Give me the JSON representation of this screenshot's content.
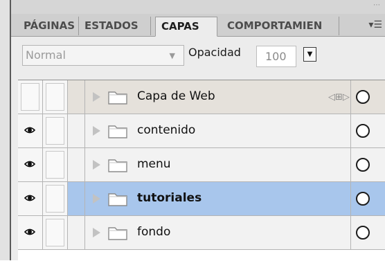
{
  "tabs": [
    {
      "label": "PÁGINAS"
    },
    {
      "label": "ESTADOS"
    },
    {
      "label": "CAPAS",
      "active": true
    },
    {
      "label": "COMPORTAMIEN"
    }
  ],
  "panel_menu_icon": "panel-menu-icon",
  "toolbar": {
    "blend_mode": "Normal",
    "opacity_label": "Opacidad",
    "opacity_value": "100"
  },
  "layers": [
    {
      "name": "Capa de Web",
      "visible": false,
      "kind": "web-layer"
    },
    {
      "name": "contenido",
      "visible": true
    },
    {
      "name": "menu",
      "visible": true
    },
    {
      "name": "tutoriales",
      "visible": true,
      "selected": true
    },
    {
      "name": "fondo",
      "visible": true
    }
  ],
  "colors": {
    "selected_row": "#a8c6ec",
    "web_layer_row": "#e5e1db",
    "panel_bg": "#ececec"
  }
}
